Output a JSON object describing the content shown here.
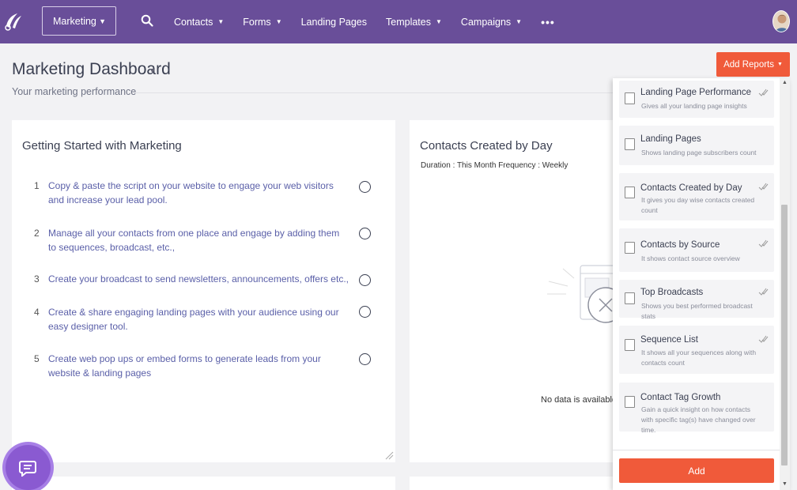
{
  "nav": {
    "app_switcher": "Marketing",
    "items": [
      {
        "label": "Contacts",
        "caret": true
      },
      {
        "label": "Forms",
        "caret": true
      },
      {
        "label": "Landing Pages",
        "caret": false
      },
      {
        "label": "Templates",
        "caret": true
      },
      {
        "label": "Campaigns",
        "caret": true
      }
    ],
    "more": "•••"
  },
  "header": {
    "title": "Marketing Dashboard",
    "subtitle": "Your marketing performance",
    "add_reports": "Add Reports"
  },
  "getting_started": {
    "title": "Getting Started with Marketing",
    "tasks": [
      {
        "num": "1",
        "text": "Copy & paste the script on your website to engage your web visitors and increase your lead pool."
      },
      {
        "num": "2",
        "text": "Manage all your contacts from one place and engage by adding them to sequences, broadcast, etc.,"
      },
      {
        "num": "3",
        "text": "Create your broadcast to send newsletters, announcements, offers etc.,"
      },
      {
        "num": "4",
        "text": "Create & share engaging landing pages with your audience using our easy designer tool."
      },
      {
        "num": "5",
        "text": "Create web pop ups or embed forms to generate leads from your website & landing pages"
      }
    ]
  },
  "contacts_by_day": {
    "title": "Contacts Created by Day",
    "duration": "Duration : This Month Frequency : Weekly",
    "no_data": "No data is available fo"
  },
  "reports_panel": {
    "items": [
      {
        "title": "Landing Page Performance",
        "desc": "Gives all your landing page insights"
      },
      {
        "title": "Landing Pages",
        "desc": "Shows landing page subscribers count"
      },
      {
        "title": "Contacts Created by Day",
        "desc": "It gives you day wise contacts created count"
      },
      {
        "title": "Contacts by Source",
        "desc": "It shows contact source overview"
      },
      {
        "title": "Top Broadcasts",
        "desc": "Shows you best performed broadcast stats"
      },
      {
        "title": "Sequence List",
        "desc": "It shows all your sequences along with contacts count"
      },
      {
        "title": "Contact Tag Growth",
        "desc": "Gain a quick insight on how contacts with specific tag(s) have changed over time."
      }
    ],
    "add_label": "Add"
  },
  "colors": {
    "nav_bg": "#694e99",
    "accent": "#f05a3a",
    "chat_bg": "#8a5ad1"
  }
}
